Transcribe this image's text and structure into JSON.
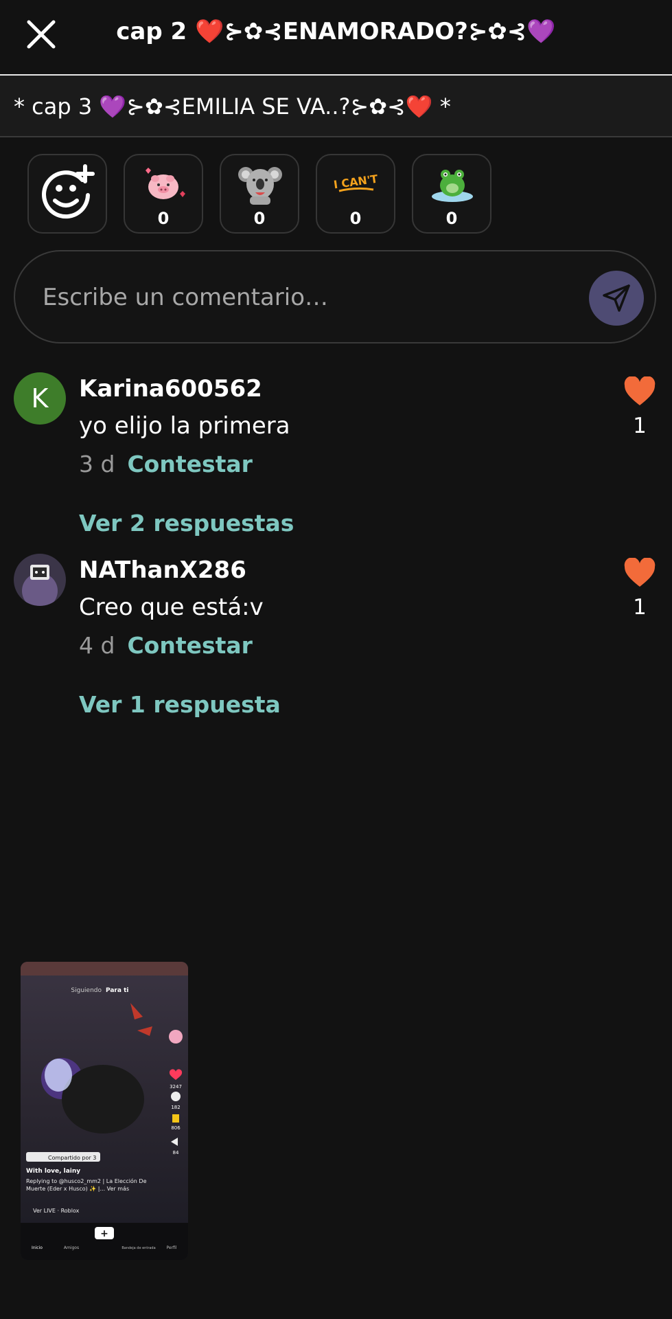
{
  "header": {
    "title": "cap 2 ❤️⊱✿⊰ENAMORADO?⊱✿⊰💜"
  },
  "next_chapter": {
    "label": "* cap 3 💜⊱✿⊰EMILIA SE VA..?⊱✿⊰❤️ *"
  },
  "reactions": [
    {
      "icon": "add-reaction-icon"
    },
    {
      "icon": "pig-sticker-icon",
      "count": "0"
    },
    {
      "icon": "koala-sticker-icon",
      "count": "0"
    },
    {
      "icon": "i-cant-sticker-icon",
      "count": "0",
      "sticker_text": "I CAN'T"
    },
    {
      "icon": "frog-sticker-icon",
      "count": "0"
    }
  ],
  "comment_box": {
    "placeholder": "Escribe un comentario…"
  },
  "comments": [
    {
      "avatar_letter": "K",
      "username": "Karina600562",
      "text": "yo elijo la primera",
      "time": "3 d",
      "reply_label": "Contestar",
      "likes": "1",
      "view_replies": "Ver 2 respuestas"
    },
    {
      "username": "NAThanX286",
      "text": "Creo que está:v",
      "time": "4 d",
      "reply_label": "Contestar",
      "likes": "1",
      "view_replies": "Ver 1 respuesta"
    }
  ],
  "thumbnail": {
    "tab_following": "Siguiendo",
    "tab_for_you": "Para ti",
    "shared_by": "Compartido por 3",
    "author": "With love, lainy",
    "counts": [
      "3247",
      "182",
      "806",
      "84"
    ],
    "caption": "Replying to @husco2_mm2 | La Elección De Muerte (Eder x Husco) ✨ |... Ver más",
    "live": "Ver LIVE · Roblox",
    "nav": [
      "Inicio",
      "Amigos",
      "",
      "Bandeja de entrada",
      "Perfil"
    ]
  },
  "colors": {
    "accent": "#7ec7c0",
    "like": "#f26b3a",
    "send_bg": "#4e4b73",
    "avatar_k": "#3e7d2a"
  }
}
